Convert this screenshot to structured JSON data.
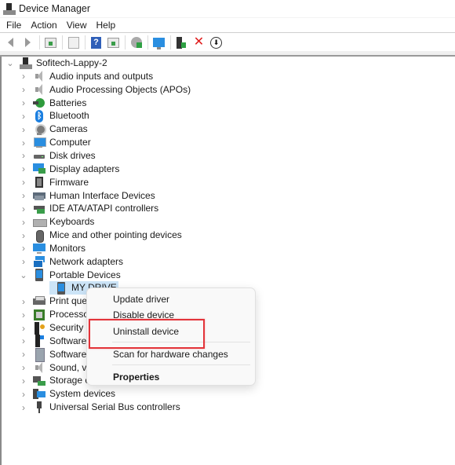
{
  "window": {
    "title": "Device Manager",
    "icon": "device-manager-icon"
  },
  "menubar": {
    "items": [
      "File",
      "Action",
      "View",
      "Help"
    ]
  },
  "toolbar": {
    "buttons": [
      {
        "name": "back-button",
        "icon": "arrow-left-icon"
      },
      {
        "name": "forward-button",
        "icon": "arrow-right-icon"
      },
      {
        "name": "show-hide-console-tree-button",
        "icon": "console-tree-icon"
      },
      {
        "name": "properties-button",
        "icon": "properties-icon"
      },
      {
        "name": "help-button",
        "icon": "help-icon",
        "glyph": "?"
      },
      {
        "name": "show-action-pane-button",
        "icon": "action-pane-icon"
      },
      {
        "name": "update-driver-button",
        "icon": "update-driver-icon"
      },
      {
        "name": "scan-hardware-button",
        "icon": "scan-hardware-icon"
      },
      {
        "name": "enable-device-button",
        "icon": "enable-device-icon"
      },
      {
        "name": "uninstall-device-button",
        "icon": "uninstall-x-icon",
        "glyph": "✕"
      },
      {
        "name": "disable-device-button",
        "icon": "disable-device-icon",
        "glyph": "⬇"
      }
    ]
  },
  "tree": {
    "root": {
      "label": "Sofitech-Lappy-2",
      "expanded": true,
      "icon": "computer-root-icon"
    },
    "categories": [
      {
        "label": "Audio inputs and outputs",
        "icon": "speaker-icon",
        "expanded": false
      },
      {
        "label": "Audio Processing Objects (APOs)",
        "icon": "speaker-icon",
        "expanded": false
      },
      {
        "label": "Batteries",
        "icon": "battery-icon",
        "expanded": false
      },
      {
        "label": "Bluetooth",
        "icon": "bluetooth-icon",
        "expanded": false
      },
      {
        "label": "Cameras",
        "icon": "camera-icon",
        "expanded": false
      },
      {
        "label": "Computer",
        "icon": "computer-icon",
        "expanded": false
      },
      {
        "label": "Disk drives",
        "icon": "disk-drive-icon",
        "expanded": false
      },
      {
        "label": "Display adapters",
        "icon": "display-adapter-icon",
        "expanded": false
      },
      {
        "label": "Firmware",
        "icon": "firmware-icon",
        "expanded": false
      },
      {
        "label": "Human Interface Devices",
        "icon": "hid-icon",
        "expanded": false
      },
      {
        "label": "IDE ATA/ATAPI controllers",
        "icon": "ide-controller-icon",
        "expanded": false
      },
      {
        "label": "Keyboards",
        "icon": "keyboard-icon",
        "expanded": false
      },
      {
        "label": "Mice and other pointing devices",
        "icon": "mouse-icon",
        "expanded": false
      },
      {
        "label": "Monitors",
        "icon": "monitor-icon",
        "expanded": false
      },
      {
        "label": "Network adapters",
        "icon": "network-adapter-icon",
        "expanded": false
      },
      {
        "label": "Portable Devices",
        "icon": "portable-device-icon",
        "expanded": true,
        "children": [
          {
            "label": "MY DRIVE",
            "icon": "portable-device-icon",
            "selected": true
          }
        ]
      },
      {
        "label": "Print queues",
        "icon": "printer-icon",
        "expanded": false
      },
      {
        "label": "Processors",
        "icon": "processor-icon",
        "expanded": false
      },
      {
        "label": "Security devices",
        "icon": "security-device-icon",
        "expanded": false
      },
      {
        "label": "Software components",
        "icon": "software-component-icon",
        "expanded": false
      },
      {
        "label": "Software devices",
        "icon": "software-device-icon",
        "expanded": false
      },
      {
        "label": "Sound, video and game controllers",
        "icon": "speaker-icon",
        "expanded": false
      },
      {
        "label": "Storage controllers",
        "icon": "storage-controller-icon",
        "expanded": false
      },
      {
        "label": "System devices",
        "icon": "system-device-icon",
        "expanded": false
      },
      {
        "label": "Universal Serial Bus controllers",
        "icon": "usb-icon",
        "expanded": false
      }
    ]
  },
  "context_menu": {
    "items": [
      {
        "label": "Update driver",
        "bold": false
      },
      {
        "label": "Disable device",
        "bold": false
      },
      {
        "label": "Uninstall device",
        "bold": false,
        "highlighted": true
      },
      {
        "separator": true
      },
      {
        "label": "Scan for hardware changes",
        "bold": false
      },
      {
        "separator": true
      },
      {
        "label": "Properties",
        "bold": true
      }
    ]
  },
  "colors": {
    "selection": "#cce4f7",
    "highlight_box": "#e3343a",
    "uninstall_x": "#e01b1b",
    "help_blue": "#2f5fb8"
  }
}
